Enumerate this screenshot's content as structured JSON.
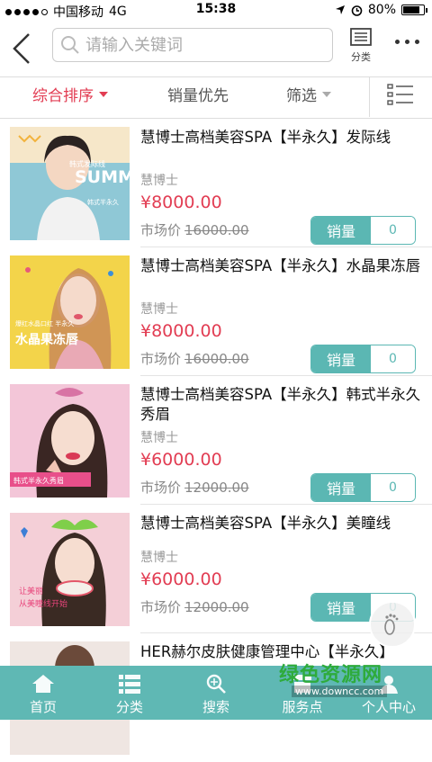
{
  "status": {
    "carrier": "中国移动",
    "network": "4G",
    "time": "15:38",
    "battery": "80%",
    "battery_level": 0.8
  },
  "header": {
    "search_placeholder": "请输入关键词",
    "category_label": "分类"
  },
  "sort": {
    "items": [
      "综合排序",
      "销量优先",
      "筛选"
    ]
  },
  "products": [
    {
      "title": "慧博士高档美容SPA【半永久】发际线",
      "brand": "慧博士",
      "price": "¥8000.00",
      "market_label": "市场价",
      "market_price": "16000.00",
      "sales_label": "销量",
      "sales_count": "0"
    },
    {
      "title": "慧博士高档美容SPA【半永久】水晶果冻唇",
      "brand": "慧博士",
      "price": "¥8000.00",
      "market_label": "市场价",
      "market_price": "16000.00",
      "sales_label": "销量",
      "sales_count": "0"
    },
    {
      "title": "慧博士高档美容SPA【半永久】韩式半永久秀眉",
      "brand": "慧博士",
      "price": "¥6000.00",
      "market_label": "市场价",
      "market_price": "12000.00",
      "sales_label": "销量",
      "sales_count": "0"
    },
    {
      "title": "慧博士高档美容SPA【半永久】美瞳线",
      "brand": "慧博士",
      "price": "¥6000.00",
      "market_label": "市场价",
      "market_price": "12000.00",
      "sales_label": "销量",
      "sales_count": "0"
    },
    {
      "title": "HER赫尔皮肤健康管理中心【半永久】",
      "brand": "",
      "price": "",
      "market_label": "",
      "market_price": "",
      "sales_label": "",
      "sales_count": ""
    }
  ],
  "thumb_text": {
    "p1_a": "韩式发际线",
    "p1_b": "SUMM",
    "p1_c": "韩式半永久",
    "p2_a": "爆红水晶口红 半永久",
    "p2_b": "水晶果冻唇",
    "p3_a": "韩式半永久秀眉",
    "p4_a": "让美丽",
    "p4_b": "从美瞳线开始"
  },
  "bottom_nav": [
    "首页",
    "分类",
    "搜索",
    "服务点",
    "个人中心"
  ],
  "watermark": {
    "text": "绿色资源网",
    "url": "www.downcc.com"
  },
  "colors": {
    "accent": "#e23d53",
    "teal": "#5fb8b4"
  }
}
